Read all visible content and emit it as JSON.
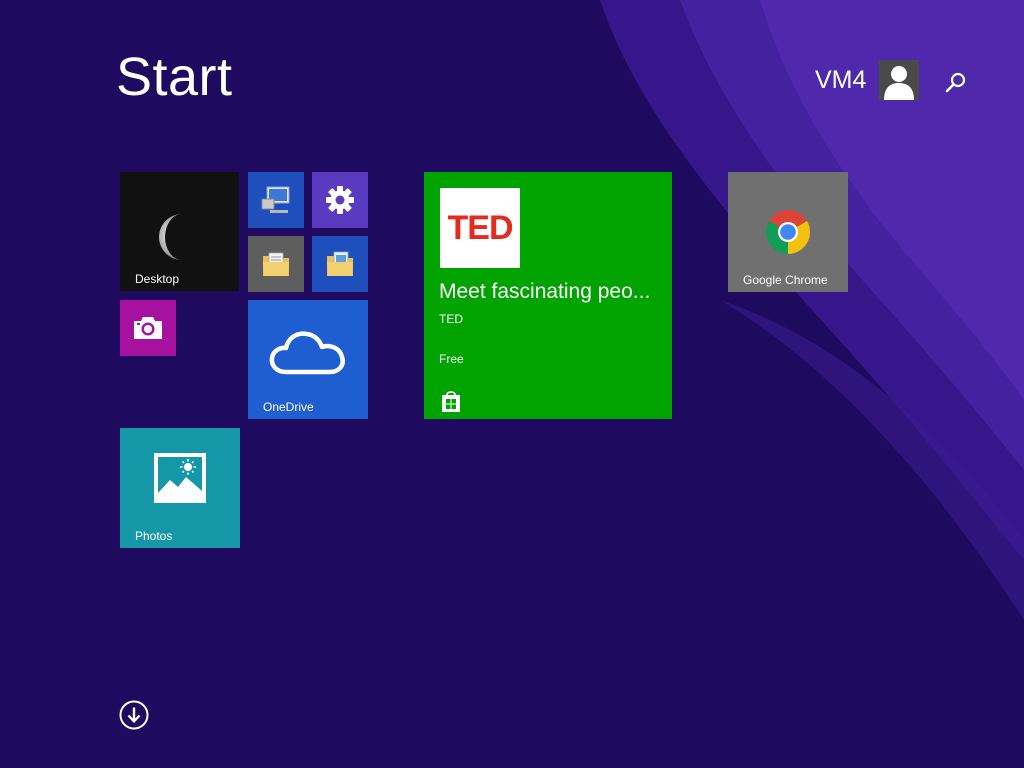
{
  "screen": {
    "title": "Start",
    "background_color": "#1e0a5e",
    "accent_swirl_color": "#5a2fb5"
  },
  "user": {
    "name": "VM4",
    "avatar_icon": "user-avatar-icon"
  },
  "search": {
    "icon": "search-icon"
  },
  "tiles": {
    "desktop": {
      "label": "Desktop",
      "color": "#111111",
      "icon": "moon-icon"
    },
    "this_pc": {
      "label": "",
      "color": "#1f4ebd",
      "icon": "computer-icon"
    },
    "settings": {
      "label": "",
      "color": "#5b3ac2",
      "icon": "gear-icon"
    },
    "documents": {
      "label": "",
      "color": "#5e5e5e",
      "icon": "folder-icon"
    },
    "file_explorer": {
      "label": "",
      "color": "#1f4ebd",
      "icon": "folder-icon"
    },
    "camera": {
      "label": "",
      "color": "#a7119f",
      "icon": "camera-icon"
    },
    "onedrive": {
      "label": "OneDrive",
      "color": "#1f5ed0",
      "icon": "cloud-icon"
    },
    "photos": {
      "label": "Photos",
      "color": "#1697a8",
      "icon": "photo-icon"
    },
    "ted": {
      "logo_text": "TED",
      "headline": "Meet fascinating peo...",
      "app_name": "TED",
      "price": "Free",
      "color": "#00a300",
      "icon": "store-bag-icon"
    },
    "chrome": {
      "label": "Google Chrome",
      "color": "#707070",
      "icon": "chrome-icon"
    }
  },
  "all_apps": {
    "icon": "down-arrow-circle-icon"
  }
}
